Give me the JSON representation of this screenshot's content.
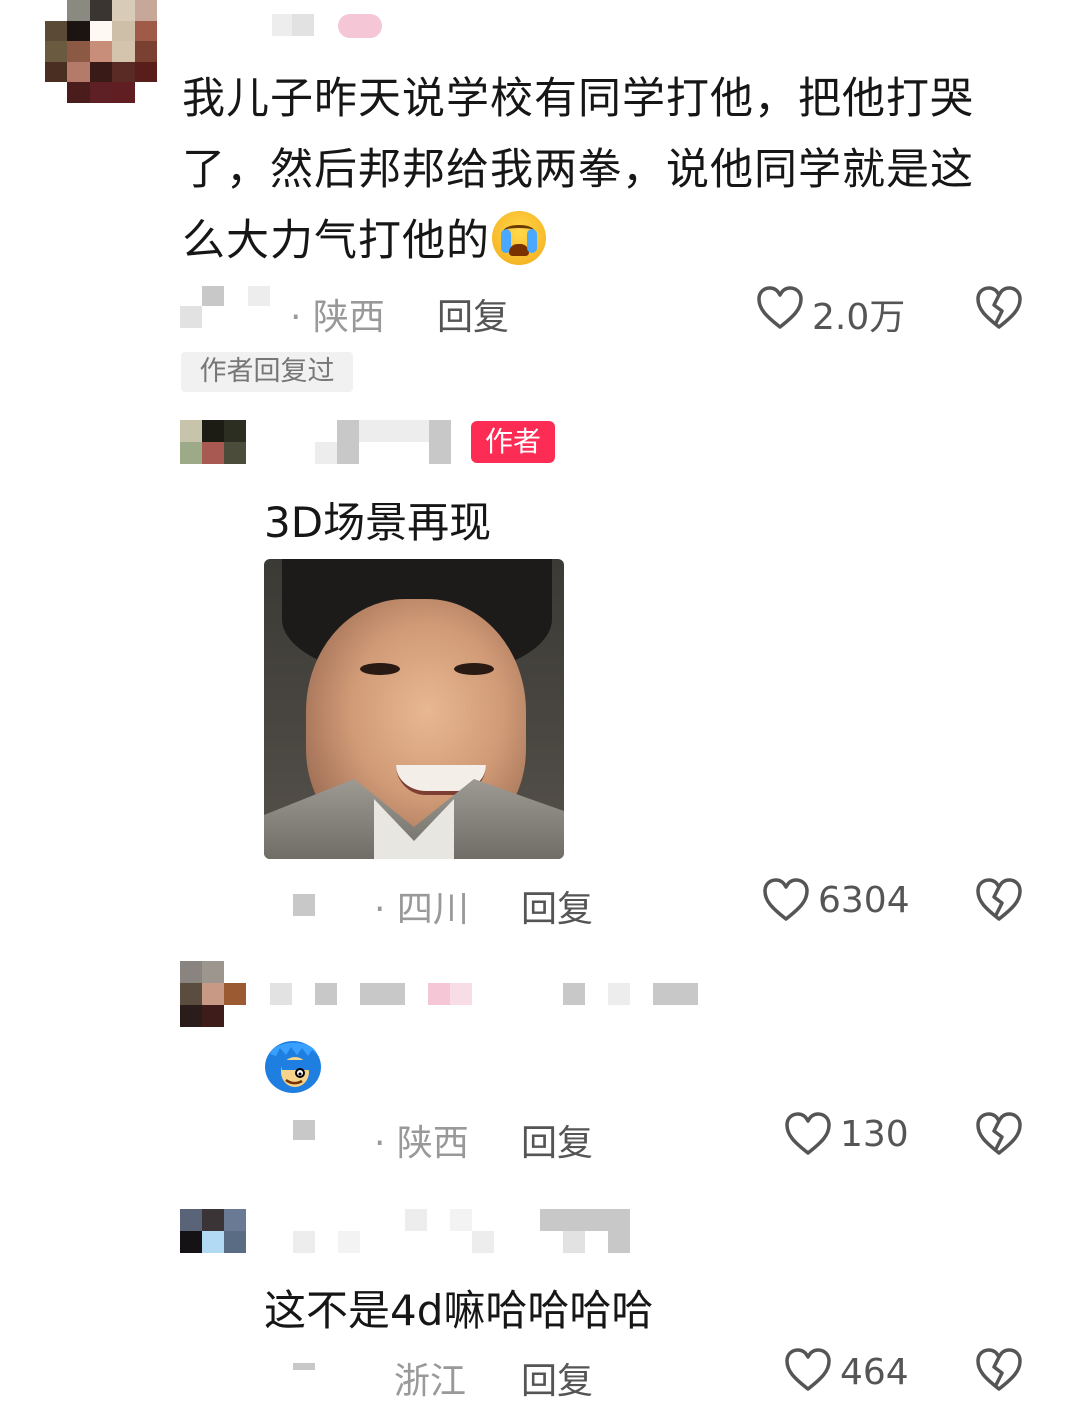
{
  "main_comment": {
    "text": "我儿子昨天说学校有同学打他，把他打哭了，然后邦邦给我两拳，说他同学就是这么大力气打他的",
    "emoji": "loudly-crying-face",
    "location": "· 陕西",
    "reply_label": "回复",
    "like_count": "2.0万",
    "author_replied_tag": "作者回复过"
  },
  "reply_1": {
    "badge": "作者",
    "text": "3D场景再现",
    "has_image": true,
    "location": "· 四川",
    "reply_label": "回复",
    "like_count": "6304"
  },
  "reply_2": {
    "sticker": "blue-hair-sticker",
    "location": "· 陕西",
    "reply_label": "回复",
    "like_count": "130"
  },
  "reply_3": {
    "text": "这不是4d嘛哈哈哈哈",
    "location": "浙江",
    "reply_label": "回复",
    "like_count": "464"
  },
  "colors": {
    "author_badge": "#fd2c54",
    "meta_text": "#999999",
    "like_text": "#555555"
  }
}
